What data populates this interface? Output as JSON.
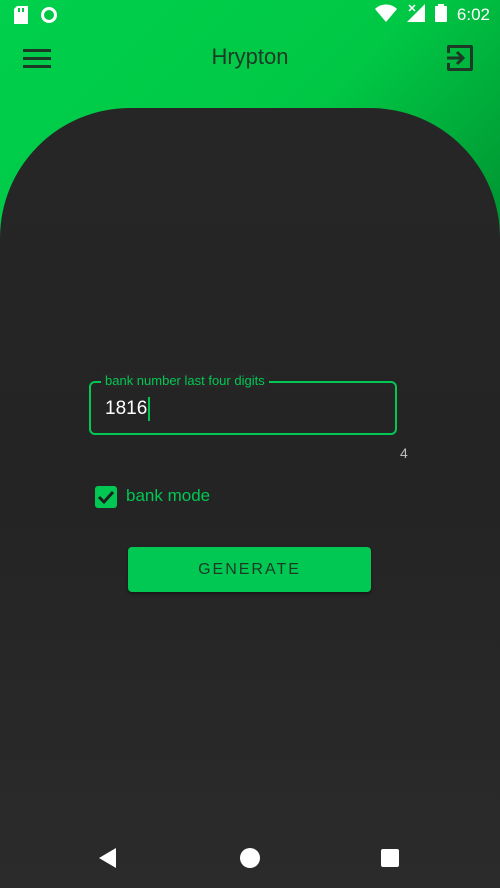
{
  "status_bar": {
    "time": "6:02",
    "icons": [
      "sd-card-icon",
      "sync-icon",
      "wifi-icon",
      "signal-icon",
      "battery-icon"
    ]
  },
  "app_bar": {
    "title": "Hrypton",
    "menu_icon": "menu-icon",
    "logout_icon": "logout-icon"
  },
  "form": {
    "field_label": "bank number last four digits",
    "field_value": "1816",
    "counter": "4",
    "checkbox_label": "bank mode",
    "checkbox_checked": true,
    "button_label": "GENERATE"
  },
  "colors": {
    "accent": "#00c853",
    "card_bg": "#262626",
    "title_text": "#1d3a26"
  },
  "nav_bar": {
    "icons": [
      "back-icon",
      "home-icon",
      "recents-icon"
    ]
  }
}
